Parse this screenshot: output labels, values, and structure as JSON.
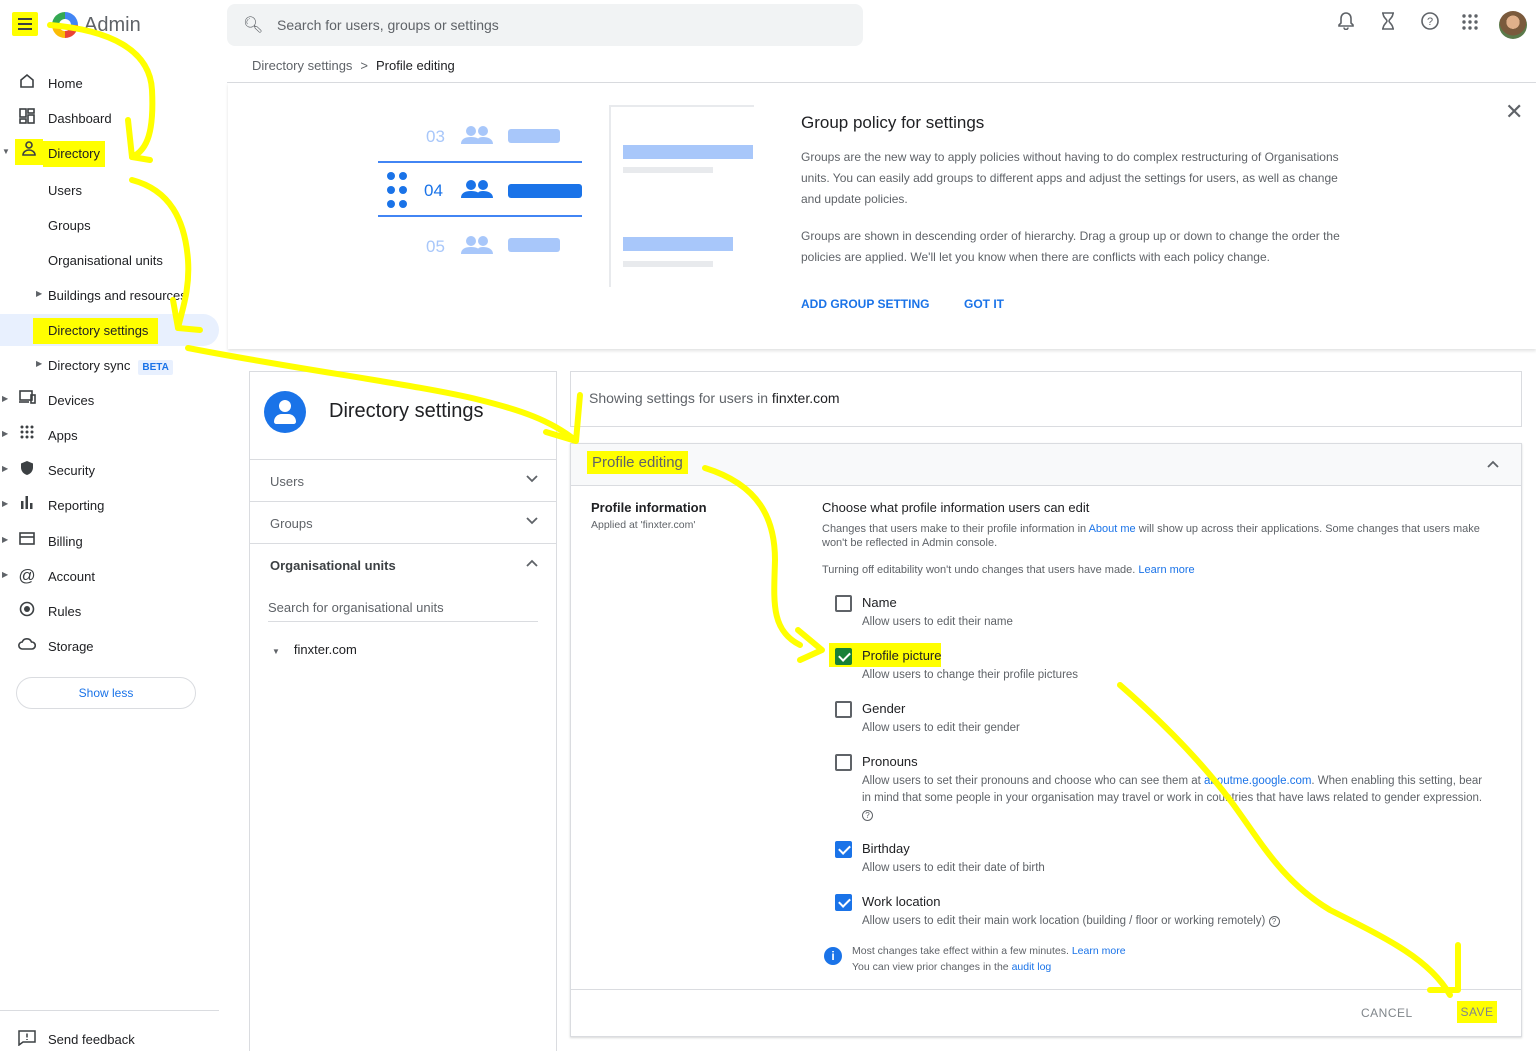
{
  "header": {
    "app_title": "Admin",
    "search_placeholder": "Search for users, groups or settings",
    "icons": [
      "bell-icon",
      "hourglass-icon",
      "help-icon",
      "apps-grid-icon",
      "avatar"
    ]
  },
  "sidebar": {
    "items": [
      {
        "label": "Home",
        "icon": "home-icon"
      },
      {
        "label": "Dashboard",
        "icon": "dashboard-icon"
      },
      {
        "label": "Directory",
        "icon": "person-icon"
      },
      {
        "label": "Users"
      },
      {
        "label": "Groups"
      },
      {
        "label": "Organisational units"
      },
      {
        "label": "Buildings and resources"
      },
      {
        "label": "Directory settings"
      },
      {
        "label": "Directory sync",
        "badge": "BETA"
      },
      {
        "label": "Devices",
        "icon": "devices-icon"
      },
      {
        "label": "Apps",
        "icon": "apps-icon"
      },
      {
        "label": "Security",
        "icon": "shield-icon"
      },
      {
        "label": "Reporting",
        "icon": "bar-chart-icon"
      },
      {
        "label": "Billing",
        "icon": "credit-card-icon"
      },
      {
        "label": "Account",
        "icon": "at-icon"
      },
      {
        "label": "Rules",
        "icon": "rules-icon"
      },
      {
        "label": "Storage",
        "icon": "cloud-icon"
      }
    ],
    "show_less": "Show less",
    "send_feedback": "Send feedback"
  },
  "breadcrumb": {
    "parent": "Directory settings",
    "separator": ">",
    "current": "Profile editing"
  },
  "banner": {
    "illustration_numbers": [
      "03",
      "04",
      "05"
    ],
    "title": "Group policy for settings",
    "paragraph1": "Groups are the new way to apply policies without having to do complex restructuring of Organisations units. You can easily add groups to different apps and adjust the settings for users, as well as change and update policies.",
    "paragraph2": "Groups are shown in descending order of hierarchy. Drag a group up or down to change the order the policies are applied. We'll let you know when there are conflicts with each policy change.",
    "add_group_setting": "ADD GROUP SETTING",
    "got_it": "GOT IT"
  },
  "left_pane": {
    "title": "Directory settings",
    "sections": [
      {
        "label": "Users",
        "expanded": false
      },
      {
        "label": "Groups",
        "expanded": false
      },
      {
        "label": "Organisational units",
        "expanded": true
      }
    ],
    "ou_search_placeholder": "Search for organisational units",
    "org": "finxter.com"
  },
  "main": {
    "showing_prefix": "Showing settings for users in",
    "showing_domain": "finxter.com",
    "card_title": "Profile editing",
    "profile_info_label": "Profile information",
    "applied_at": "Applied at 'finxter.com'",
    "choose_title": "Choose what profile information users can edit",
    "changes_desc_a": "Changes that users make to their profile information in",
    "about_me_link": "About me",
    "changes_desc_b": "will show up across their applications. Some changes that users make won't be reflected in Admin console.",
    "turning_off": "Turning off editability won't undo changes that users have made.",
    "learn_more": "Learn more",
    "options": [
      {
        "label": "Name",
        "sub": "Allow users to edit their name",
        "checked": false
      },
      {
        "label": "Profile picture",
        "sub": "Allow users to change their profile pictures",
        "checked": true
      },
      {
        "label": "Gender",
        "sub": "Allow users to edit their gender",
        "checked": false
      },
      {
        "label": "Pronouns",
        "sub_a": "Allow users to set their pronouns and choose who can see them at",
        "sub_link": "aboutme.google.com",
        "sub_b": ". When enabling this setting, bear in mind that some people in your organisation may travel or work in countries that have laws related to gender expression.",
        "checked": false
      },
      {
        "label": "Birthday",
        "sub": "Allow users to edit their date of birth",
        "checked": true
      },
      {
        "label": "Work location",
        "sub": "Allow users to edit their main work location (building / floor or working remotely)",
        "checked": true
      }
    ],
    "info_line1": "Most changes take effect within a few minutes.",
    "info_learn_more": "Learn more",
    "info_line2": "You can view prior changes in the",
    "audit_log": "audit log",
    "cancel": "CANCEL",
    "save": "SAVE"
  },
  "colors": {
    "accent": "#1a73e8",
    "highlight": "#ffff00",
    "selected_bg": "#e8f0fe"
  }
}
